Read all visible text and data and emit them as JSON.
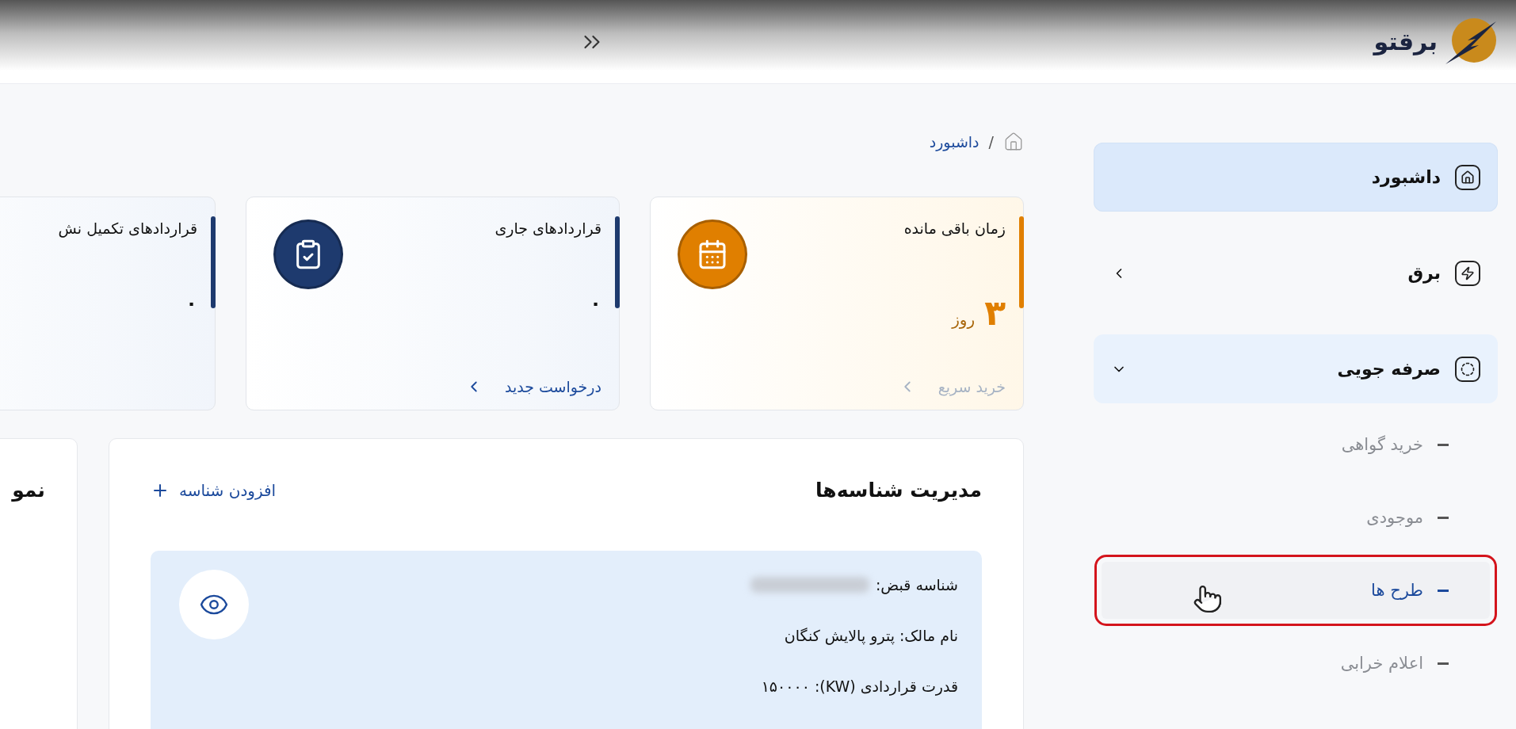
{
  "header": {
    "logo_text": "برقتو"
  },
  "sidebar": {
    "items": [
      {
        "label": "داشبورد",
        "selected": true
      },
      {
        "label": "برق",
        "selected": false,
        "expanded": false
      },
      {
        "label": "صرفه جویی",
        "selected": false,
        "expanded": true,
        "children": [
          {
            "label": "خرید گواهی",
            "selected": false,
            "highlighted": false
          },
          {
            "label": "موجودی",
            "selected": false,
            "highlighted": false
          },
          {
            "label": "طرح ها",
            "selected": true,
            "highlighted": true
          },
          {
            "label": "اعلام خرابی",
            "selected": false,
            "highlighted": false
          }
        ]
      }
    ]
  },
  "breadcrumb": {
    "separator": "/",
    "current": "داشبورد"
  },
  "cards": [
    {
      "kind": "remaining",
      "title": "زمان باقی مانده",
      "value": "۳",
      "unit": "روز",
      "color": "#e07f00",
      "link": {
        "label": "خرید سریع",
        "disabled": true
      }
    },
    {
      "kind": "current",
      "title": "قراردادهای جاری",
      "value": "۰",
      "color": "#1e3a6e",
      "link": {
        "label": "درخواست جدید",
        "disabled": false
      }
    },
    {
      "kind": "completed",
      "title": "قراردادهای تکمیل نش",
      "value": "۰",
      "color": "#1e3a6e"
    }
  ],
  "ids_panel": {
    "title": "مدیریت شناسه‌ها",
    "add_label": "افزودن شناسه",
    "entries": [
      {
        "lines": [
          "شناسه قبض:",
          "نام مالک: پترو پالایش کنگان",
          "قدرت قراردادی (KW): ۱۵۰۰۰۰"
        ]
      }
    ]
  },
  "side_panel": {
    "title": "نمو"
  }
}
